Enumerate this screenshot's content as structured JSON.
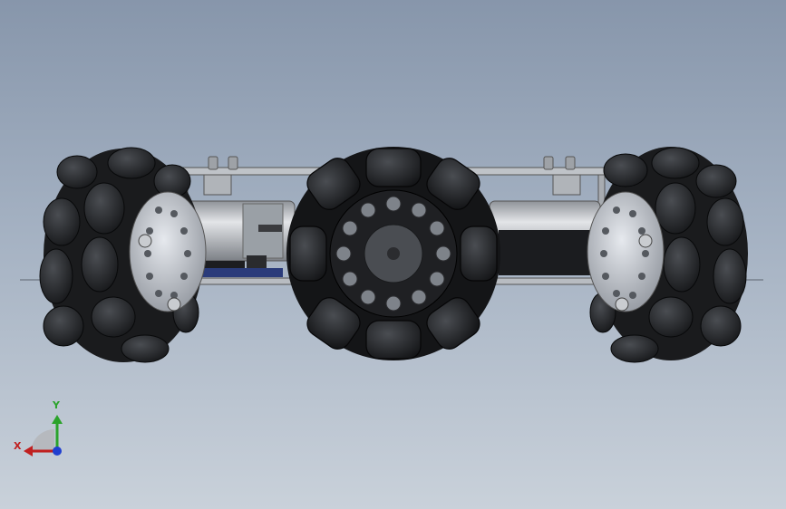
{
  "viewport": {
    "background_top": "#8796ab",
    "background_bottom": "#c9d1da"
  },
  "model": {
    "subject": "omni-wheel-robot-chassis",
    "view": "front"
  },
  "triad": {
    "x_label": "X",
    "y_label": "Y",
    "x_color": "#c02020",
    "y_color": "#2ba32b",
    "z_color": "#1f3fd0"
  }
}
